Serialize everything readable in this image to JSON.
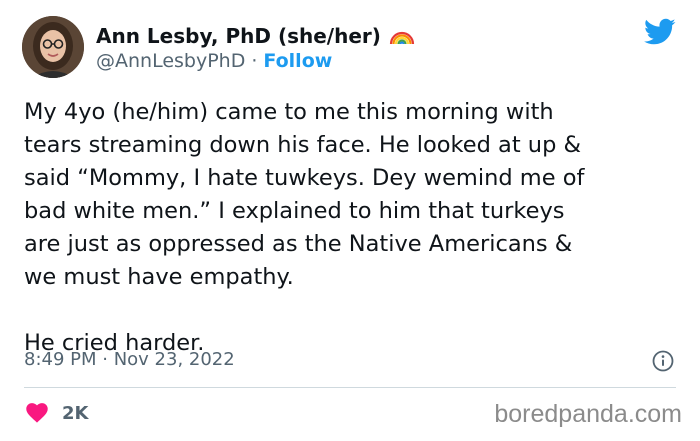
{
  "tweet": {
    "author": {
      "display_name": "Ann Lesby, PhD (she/her)",
      "badge_icon": "rainbow-icon",
      "handle": "@AnnLesbyPhD",
      "separator": "·",
      "follow_label": "Follow"
    },
    "text": "My 4yo (he/him) came to me this morning with\ntears streaming down his face. He looked at up &\nsaid “Mommy, I hate tuwkeys. Dey wemind me of\nbad white men.” I explained to him that turkeys\nare just as oppressed as the Native Americans &\nwe must have empathy.\n\nHe cried harder.",
    "timestamp": "8:49 PM · Nov 23, 2022",
    "likes": "2K",
    "brand_icon": "twitter-bird-icon",
    "info_icon": "info-icon",
    "like_icon": "heart-icon"
  },
  "watermark": "boredpanda.com",
  "colors": {
    "accent": "#1d9bf0",
    "like": "#f91880",
    "secondary_text": "#536471",
    "divider": "#cfd9de"
  }
}
